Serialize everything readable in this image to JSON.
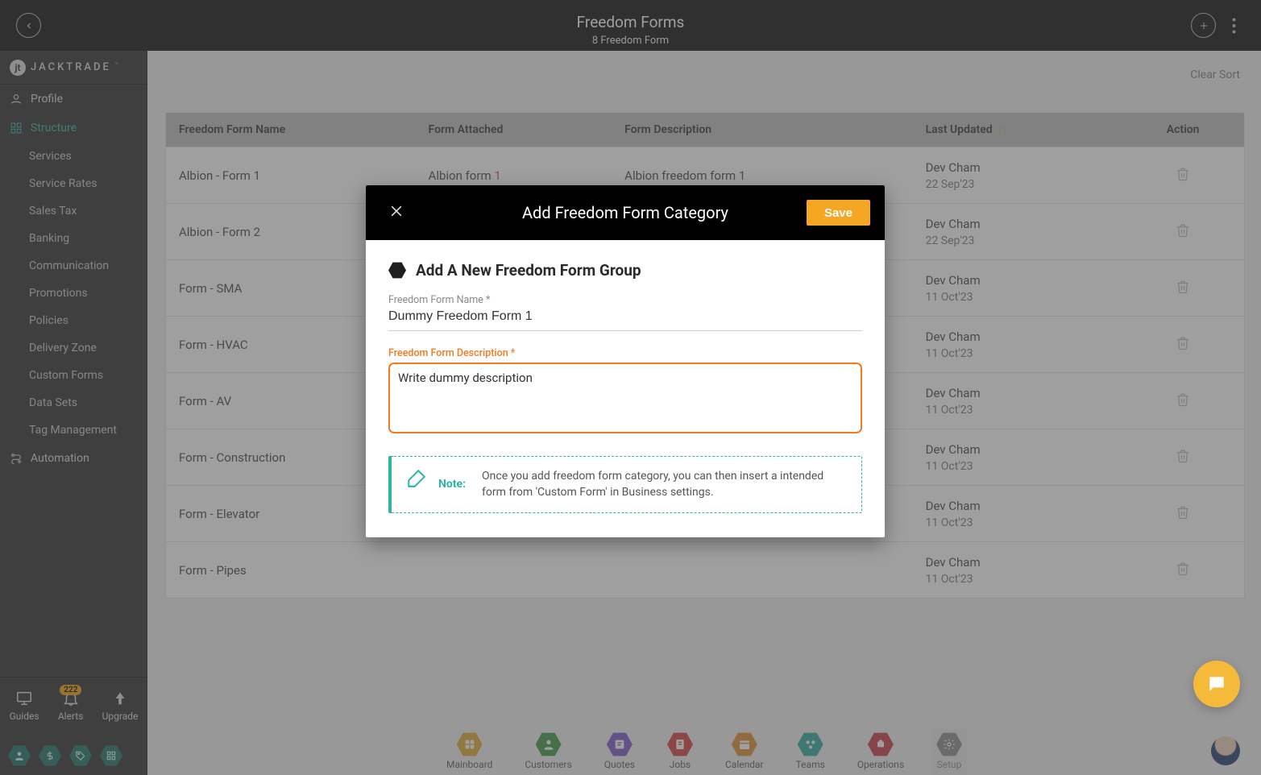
{
  "header": {
    "title": "Freedom Forms",
    "subtitle": "8 Freedom Form"
  },
  "brand": {
    "text": "JACKTRADE",
    "tm": "™"
  },
  "sidebar": {
    "profile": "Profile",
    "structure": "Structure",
    "structure_items": [
      "Services",
      "Service Rates",
      "Sales Tax",
      "Banking",
      "Communication",
      "Promotions",
      "Policies",
      "Delivery Zone",
      "Custom Forms",
      "Data Sets",
      "Tag Management"
    ],
    "automation": "Automation",
    "bottom": {
      "guides": "Guides",
      "alerts": "Alerts",
      "alerts_badge": "222",
      "upgrade": "Upgrade"
    }
  },
  "main": {
    "clear_sort": "Clear Sort",
    "columns": {
      "name": "Freedom Form Name",
      "attached": "Form Attached",
      "desc": "Form Description",
      "updated": "Last Updated",
      "action": "Action"
    },
    "rows": [
      {
        "name": "Albion - Form 1",
        "attached_prefix": "Albion form ",
        "attached_num": "1",
        "desc": "Albion freedom form 1",
        "updated_by": "Dev Cham",
        "updated_on": "22 Sep'23"
      },
      {
        "name": "Albion - Form 2",
        "attached_prefix": "",
        "attached_num": "",
        "desc": "",
        "updated_by": "Dev Cham",
        "updated_on": "22 Sep'23"
      },
      {
        "name": "Form - SMA",
        "attached_prefix": "",
        "attached_num": "",
        "desc": "",
        "updated_by": "Dev Cham",
        "updated_on": "11 Oct'23"
      },
      {
        "name": "Form - HVAC",
        "attached_prefix": "",
        "attached_num": "",
        "desc": "",
        "updated_by": "Dev Cham",
        "updated_on": "11 Oct'23"
      },
      {
        "name": "Form - AV",
        "attached_prefix": "",
        "attached_num": "",
        "desc": "",
        "updated_by": "Dev Cham",
        "updated_on": "11 Oct'23"
      },
      {
        "name": "Form - Construction",
        "attached_prefix": "",
        "attached_num": "",
        "desc": "",
        "updated_by": "Dev Cham",
        "updated_on": "11 Oct'23"
      },
      {
        "name": "Form - Elevator",
        "attached_prefix": "",
        "attached_num": "",
        "desc": "",
        "updated_by": "Dev Cham",
        "updated_on": "11 Oct'23"
      },
      {
        "name": "Form - Pipes",
        "attached_prefix": "",
        "attached_num": "",
        "desc": "",
        "updated_by": "Dev Cham",
        "updated_on": "11 Oct'23"
      }
    ]
  },
  "bottomnav": {
    "items": [
      "Mainboard",
      "Customers",
      "Quotes",
      "Jobs",
      "Calendar",
      "Teams",
      "Operations",
      "Setup"
    ],
    "colors": [
      "#e0a92e",
      "#3a9a3f",
      "#7a55c7",
      "#d83a3a",
      "#e08a2e",
      "#2aa79e",
      "#c8393f",
      "#8a8a8a"
    ]
  },
  "modal": {
    "title": "Add Freedom Form Category",
    "save": "Save",
    "group_title": "Add A New Freedom Form Group",
    "name_label": "Freedom Form Name *",
    "name_value": "Dummy Freedom Form 1",
    "desc_label": "Freedom Form Description *",
    "desc_value": "Write dummy description",
    "note_label": "Note:",
    "note_text": "Once you add freedom form category, you can then insert a intended form from 'Custom Form' in Business settings."
  }
}
